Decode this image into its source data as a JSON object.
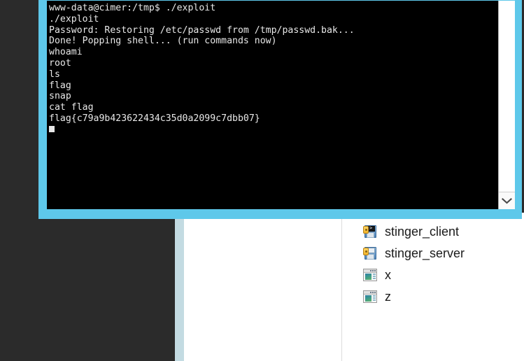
{
  "theme": {
    "terminal_border_color": "#5ec8ea",
    "terminal_background": "#000000",
    "terminal_text_color": "#e8e8e8",
    "desktop_dark_panel": "#2b2b2b",
    "desktop_light_strip": "#c3dbe2",
    "panel_background": "#ffffff",
    "divider_color": "#dcdcdc",
    "file_label_color": "#1b1b1b"
  },
  "terminal": {
    "lines": [
      "www-data@cimer:/tmp$ ./exploit",
      "./exploit",
      "Password: Restoring /etc/passwd from /tmp/passwd.bak...",
      "Done! Popping shell... (run commands now)",
      "whoami",
      "root",
      "ls",
      "flag",
      "snap",
      "cat flag",
      "flag{c79a9b423622434c35d0a2099c7dbb07}"
    ],
    "prompt_user": "www-data",
    "prompt_host": "cimer",
    "prompt_path": "/tmp",
    "prompt_symbol": "$",
    "flag_value": "flag{c79a9b423622434c35d0a2099c7dbb07}",
    "cursor_visible": true,
    "scrollbar": {
      "down_arrow_glyph": "chevron-down"
    }
  },
  "file_list": {
    "items": [
      {
        "name": "stinger_client",
        "icon": "floppy-key-terminal-icon"
      },
      {
        "name": "stinger_server",
        "icon": "floppy-key-icon"
      },
      {
        "name": "x",
        "icon": "window-app-icon"
      },
      {
        "name": "z",
        "icon": "window-app-icon"
      }
    ]
  }
}
